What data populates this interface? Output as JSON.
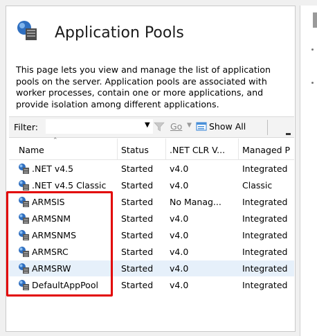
{
  "header": {
    "title": "Application Pools",
    "icon": "app-pools-icon"
  },
  "description": "This page lets you view and manage the list of application pools on the server. Application pools are associated with worker processes, contain one or more applications, and provide isolation among different applications.",
  "toolbar": {
    "filter_label": "Filter:",
    "filter_value": "",
    "go_label": "Go",
    "show_all_label": "Show All"
  },
  "columns": [
    "Name",
    "Status",
    ".NET CLR V...",
    "Managed P"
  ],
  "rows": [
    {
      "name": ".NET v4.5",
      "status": "Started",
      "clr": "v4.0",
      "pipeline": "Integrated"
    },
    {
      "name": ".NET v4.5 Classic",
      "status": "Started",
      "clr": "v4.0",
      "pipeline": "Classic"
    },
    {
      "name": "ARMSIS",
      "status": "Started",
      "clr": "No Manag...",
      "pipeline": "Integrated"
    },
    {
      "name": "ARMSNM",
      "status": "Started",
      "clr": "v4.0",
      "pipeline": "Integrated"
    },
    {
      "name": "ARMSNMS",
      "status": "Started",
      "clr": "v4.0",
      "pipeline": "Integrated"
    },
    {
      "name": "ARMSRC",
      "status": "Started",
      "clr": "v4.0",
      "pipeline": "Integrated"
    },
    {
      "name": "ARMSRW",
      "status": "Started",
      "clr": "v4.0",
      "pipeline": "Integrated",
      "selected": true
    },
    {
      "name": "DefaultAppPool",
      "status": "Started",
      "clr": "v4.0",
      "pipeline": "Integrated"
    }
  ],
  "colors": {
    "selection": "#e6f0fa",
    "highlight_box": "#e20000"
  }
}
